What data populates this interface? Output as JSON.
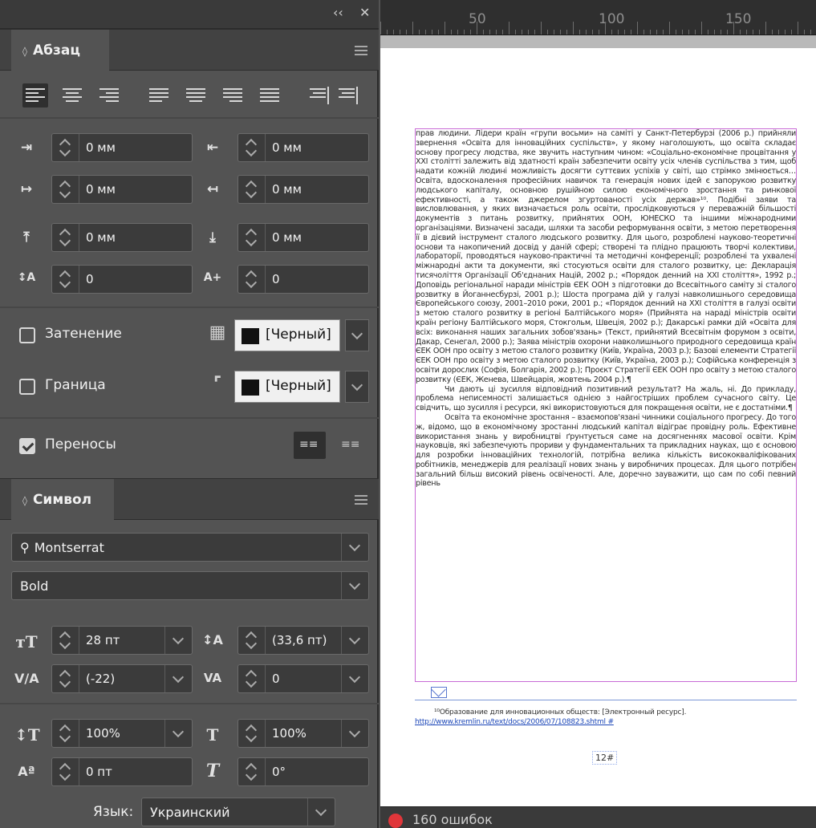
{
  "panel_controls": {
    "collapse": "‹‹",
    "close": "✕"
  },
  "paragraph": {
    "title": "Абзац",
    "indents": {
      "left": "0 мм",
      "right": "0 мм",
      "first_line": "0 мм",
      "last_line": "0 мм",
      "space_before": "0 мм",
      "space_after": "0 мм",
      "drop_cap_lines": "0",
      "drop_cap_chars": "0"
    },
    "shading_label": "Затенение",
    "shading_color": "[Черный]",
    "border_label": "Граница",
    "border_color": "[Черный]",
    "hyphenate_label": "Переносы",
    "hyphenate_checked": true
  },
  "character": {
    "title": "Символ",
    "font_family": "Montserrat",
    "font_style": "Bold",
    "size": "28 пт",
    "leading": "(33,6 пт)",
    "kerning": "(-22)",
    "tracking": "0",
    "vertical_scale": "100%",
    "horizontal_scale": "100%",
    "baseline_shift": "0 пт",
    "skew": "0°",
    "language_label": "Язык:",
    "language": "Украинский"
  },
  "ruler": {
    "marks": [
      "50",
      "100",
      "150"
    ]
  },
  "document": {
    "paragraphs": [
      "прав людини. Лідери країн «групи восьми» на саміті у Санкт-Петербурзі (2006 р.) прийняли звернення «Освіта для інноваційних суспільств», у якому наголошують, що освіта складає основу прогресу людства, яке звучить наступним чином: «Соціально-економічне процвітання у XXI столітті залежить від здатності країн забезпечити освіту усіх членів суспільства з тим, щоб надати кожній людині можливість досягти суттєвих успіхів у світі, що стрімко змінюється… Освіта, вдосконалення професійних навичок та генерація нових ідей є запорукою розвитку людського капіталу, основною рушійною силою економічного зростання та ринкової ефективності, а також джерелом згуртованості усіх держав»¹⁰. Подібні заяви та висловлювання, у яких визначається роль освіти, прослідковуються у переважній більшості документів з питань розвитку, прийнятих ООН, ЮНЕСКО та іншими міжнародними організаціями. Визначені засади, шляхи та засоби реформування освіти, з метою перетворення її в дієвий інструмент сталого людського розвитку. Для цього, розроблені науково-теоретичні основи та накопичений досвід у даній сфері; створені та плідно працюють творчі колективи, лабораторії, проводяться науково-практичні та методичні конференції; розроблені та ухвалені міжнародні акти та документи, які стосуються освіти для сталого розвитку, це: Декларація тисячоліття Організації Об'єднаних Націй, 2002 р.; «Порядок денний на XXI століття», 1992 р.; Доповідь регіональної наради міністрів ЄЕК ООН з підготовки до Всесвітнього саміту зі сталого розвитку в Йоганнесбурзі, 2001 р.); Шоста програма дій у галузі навколишнього середовища Європейського союзу, 2001–2010 роки, 2001 р.; «Порядок денний на XXI століття в галузі освіти з метою сталого розвитку в регіоні Балтійського моря» (Прийнята на нараді міністрів освіти країн регіону Балтійського моря, Стокгольм, Швеція, 2002 р.); Дакарські рамки дій «Освіта для всіх: виконання наших загальних зобов'язань» (Текст, прийнятий Всесвітнім форумом з освіти, Дакар, Сенегал, 2000 р.); Заява міністрів охорони навколишнього природного середовища країн ЄЕК ООН про освіту з метою сталого розвитку (Київ, Україна, 2003 р.); Базові елементи Стратегії ЄЕК ООН про освіту з метою сталого розвитку (Київ, Україна, 2003 р.); Софійська конференція з освіти дорослих (Софія, Болгарія, 2002 р.); Проєкт Стратегії ЄЕК ООН про освіту з метою сталого розвитку (ЄЕК, Женева, Швейцарія, жовтень 2004 р.).¶",
      "Чи дають ці зусилля відповідний позитивний результат? На жаль, ні. До прикладу, проблема неписемності залишається однією з найгостріших проблем сучасного світу. Це свідчить, що зусилля і ресурси, які використовуються для покращення освіти, не є достатніми.¶",
      "Освіта та економічне зростання – взаємопов'язані чинники соціального прогресу. До того ж, відомо, що в економічному зростанні людський капітал відіграє провідну роль. Ефективне використання знань у виробництві ґрунтується саме на досягненнях масової освіти. Крім науковців, які забезпечують прориви у фундаментальних та прикладних науках, що є основою для розробки інноваційних технологій, потрібна велика кількість висококваліфікованих робітників, менеджерів для реалізації нових знань у виробничих процесах. Для цього потрібен загальний більш високий рівень освіченості. Але, доречно зауважити, що сам по собі певний рівень"
    ],
    "footnote_text": "¹⁰Образование для инновационных обществ: [Электронный ресурс]. ",
    "footnote_link": "http://www.kremlin.ru/text/docs/2006/07/108823.shtml #",
    "page_number": "12#"
  },
  "status": {
    "errors": "160 ошибок"
  }
}
